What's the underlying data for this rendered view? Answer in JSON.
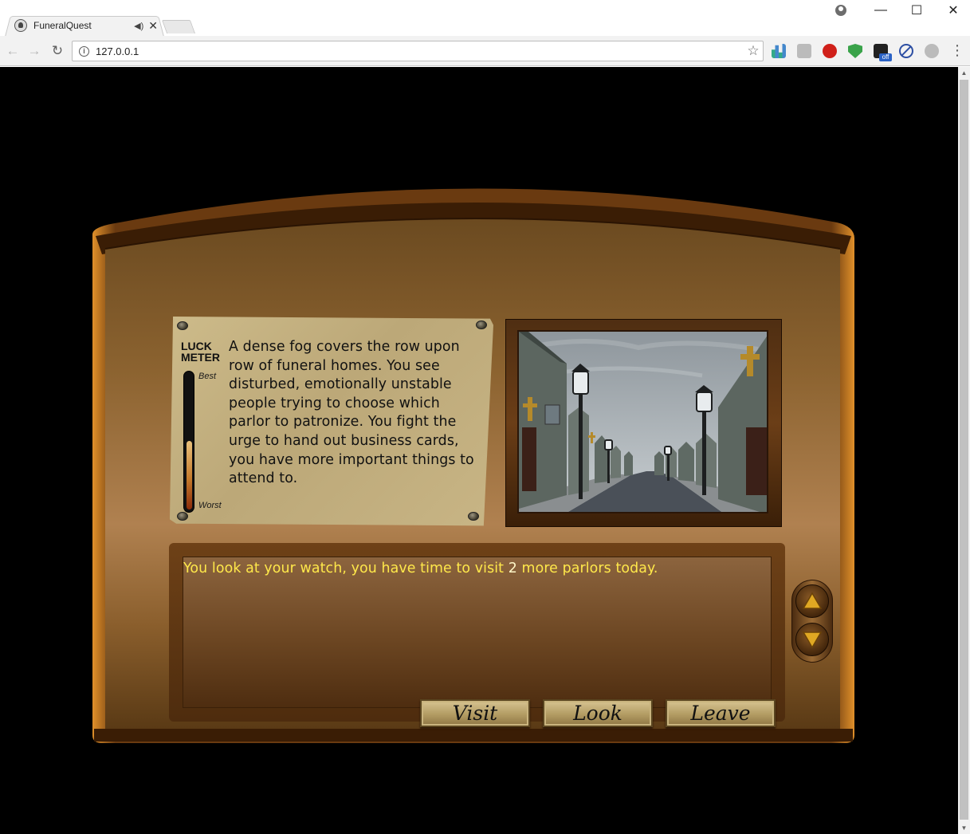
{
  "browser": {
    "tab_title": "FuneralQuest",
    "url": "127.0.0.1",
    "tab_audio_icon": "speaker-icon",
    "tab_close_glyph": "✕",
    "ext_badge": "off"
  },
  "luck_meter": {
    "title": "LUCK METER",
    "best_label": "Best",
    "worst_label": "Worst",
    "level_fraction": 0.5
  },
  "scene": {
    "description": "A dense fog covers the row upon row of funeral homes. You see disturbed, emotionally unstable people trying to choose which parlor to patronize.  You fight the urge to hand out business cards, you have more important things to attend to."
  },
  "message": {
    "prefix": "You look at your watch, you have time to visit ",
    "count": "2",
    "suffix": " more parlors today."
  },
  "actions": {
    "visit": "Visit",
    "look": "Look",
    "leave": "Leave"
  },
  "colors": {
    "message_text": "#ffe84a",
    "background": "#000000"
  }
}
